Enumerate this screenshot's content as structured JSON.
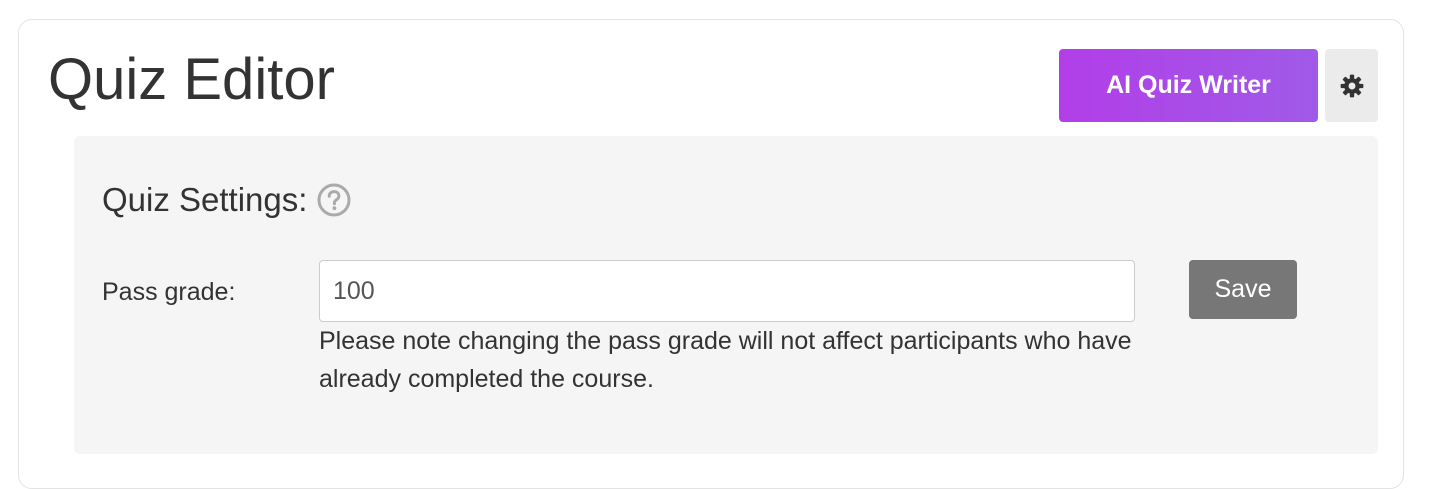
{
  "header": {
    "title": "Quiz Editor",
    "ai_button_label": "AI Quiz Writer",
    "settings_icon": "gear-icon"
  },
  "settings": {
    "title": "Quiz Settings:",
    "help_icon": "question-circle-icon",
    "pass_grade_label": "Pass grade:",
    "pass_grade_value": "100",
    "note": "Please note changing the pass grade will not affect participants who have already completed the course.",
    "save_label": "Save"
  },
  "colors": {
    "ai_button_gradient_start": "#b23ee8",
    "ai_button_gradient_end": "#a05ae8",
    "save_button": "#777777",
    "panel_background": "#f5f5f5",
    "settings_button_background": "#ebebeb"
  }
}
